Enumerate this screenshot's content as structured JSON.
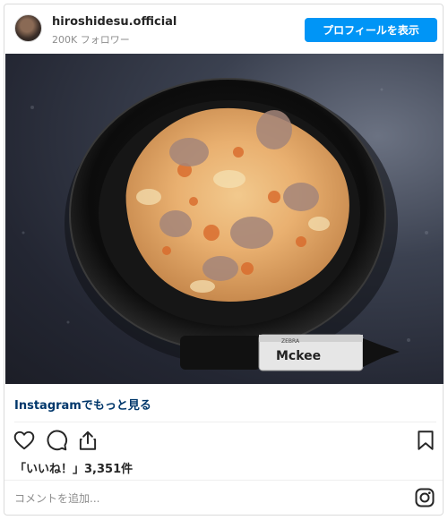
{
  "header": {
    "username": "hiroshidesu.official",
    "followers": "200K フォロワー",
    "profile_button": "プロフィールを表示"
  },
  "post": {
    "marker_brand": "ZEBRA",
    "marker_text": "Mckee"
  },
  "links": {
    "more_on_instagram": "Instagramでもっと見る"
  },
  "actions": {
    "icons": [
      "heart-icon",
      "comment-icon",
      "share-icon",
      "bookmark-icon"
    ]
  },
  "likes": {
    "text": "「いいね！」3,351件"
  },
  "comment": {
    "placeholder": "コメントを追加..."
  },
  "colors": {
    "accent": "#0095f6",
    "link": "#00376b",
    "muted": "#8e8e8e"
  }
}
